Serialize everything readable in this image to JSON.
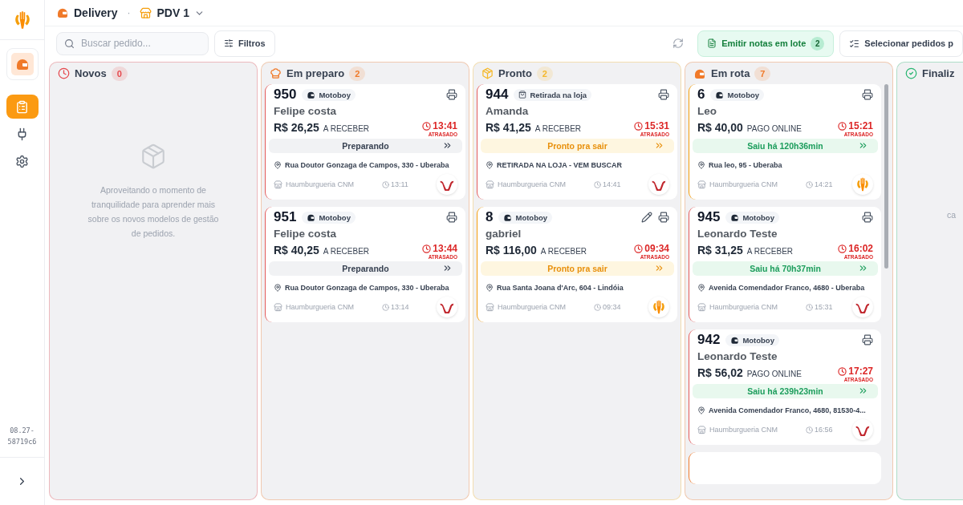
{
  "header": {
    "title": "Delivery",
    "separator": "·",
    "store": "PDV 1"
  },
  "sidebar": {
    "nav": [
      {
        "kind": "orders",
        "selected": true
      },
      {
        "kind": "integrations",
        "selected": false
      },
      {
        "kind": "settings",
        "selected": false
      }
    ],
    "version": "08.27-58719c6"
  },
  "toolbar": {
    "search": {
      "placeholder": "Buscar pedido..."
    },
    "filters": "Filtros",
    "emit": {
      "label": "Emitir notas em lote",
      "count": "2"
    },
    "select": "Selecionar pedidos p"
  },
  "columns": [
    {
      "kind": "clock",
      "title": "Novos",
      "count": "0",
      "color": "#e5484d",
      "empty_text": "Aproveitando o momento de tranquilidade para aprender mais sobre os novos modelos de gestão de pedidos."
    },
    {
      "kind": "chef",
      "title": "Em preparo",
      "count": "2",
      "color": "#f07a2a",
      "cards": [
        {
          "number": "950",
          "tag": {
            "kind": "motoboy",
            "label": "Motoboy"
          },
          "name": "Felipe costa",
          "price": "R$ 26,25",
          "payment": "A RECEBER",
          "due": "13:41",
          "late": "ATRASADO",
          "status": {
            "kind": "preparing",
            "label": "Preparando"
          },
          "address": "Rua Doutor Gonzaga de Campos, 330 - Uberaba",
          "store": "Haumburgueria CNM",
          "time": "13:11",
          "logo": {
            "kind": "wave"
          },
          "editable": false
        },
        {
          "number": "951",
          "tag": {
            "kind": "motoboy",
            "label": "Motoboy"
          },
          "name": "Felipe costa",
          "price": "R$ 40,25",
          "payment": "A RECEBER",
          "due": "13:44",
          "late": "ATRASADO",
          "status": {
            "kind": "preparing",
            "label": "Preparando"
          },
          "address": "Rua Doutor Gonzaga de Campos, 330 - Uberaba",
          "store": "Haumburgueria CNM",
          "time": "13:14",
          "logo": {
            "kind": "wave"
          },
          "editable": false
        }
      ]
    },
    {
      "kind": "box",
      "title": "Pronto",
      "count": "2",
      "color": "#f5b82a",
      "cards": [
        {
          "number": "944",
          "tag": {
            "kind": "pickup",
            "label": "Retirada na loja"
          },
          "name": "Amanda",
          "price": "R$ 41,25",
          "payment": "A RECEBER",
          "due": "15:31",
          "late": "ATRASADO",
          "status": {
            "kind": "ready",
            "label": "Pronto pra sair"
          },
          "address": "RETIRADA NA LOJA - VEM BUSCAR",
          "store": "Haumburgueria CNM",
          "time": "14:41",
          "logo": {
            "kind": "wave"
          },
          "editable": false
        },
        {
          "number": "8",
          "tag": {
            "kind": "motoboy",
            "label": "Motoboy"
          },
          "name": "gabriel",
          "price": "R$ 116,00",
          "payment": "A RECEBER",
          "due": "09:34",
          "late": "ATRASADO",
          "status": {
            "kind": "ready",
            "label": "Pronto pra sair"
          },
          "address": "Rua Santa Joana d'Arc, 604 - Lindóia",
          "store": "Haumburgueria CNM",
          "time": "09:34",
          "logo": {
            "kind": "hand"
          },
          "editable": true
        }
      ]
    },
    {
      "kind": "helmet",
      "title": "Em rota",
      "count": "7",
      "color": "#f07a2a",
      "cards": [
        {
          "number": "6",
          "tag": {
            "kind": "motoboy",
            "label": "Motoboy"
          },
          "name": "Leo",
          "price": "R$ 40,00",
          "payment": "PAGO ONLINE",
          "due": "15:21",
          "late": "ATRASADO",
          "status": {
            "kind": "out",
            "label": "Saiu há 120h36min"
          },
          "address": "Rua leo, 95 - Uberaba",
          "store": "Haumburgueria CNM",
          "time": "14:21",
          "logo": {
            "kind": "hand"
          },
          "editable": false
        },
        {
          "number": "945",
          "tag": {
            "kind": "motoboy",
            "label": "Motoboy"
          },
          "name": "Leonardo Teste",
          "price": "R$ 31,25",
          "payment": "A RECEBER",
          "due": "16:02",
          "late": "ATRASADO",
          "status": {
            "kind": "out",
            "label": "Saiu há 70h37min"
          },
          "address": "Avenida Comendador Franco, 4680 - Uberaba",
          "store": "Haumburgueria CNM",
          "time": "15:31",
          "logo": {
            "kind": "wave"
          },
          "editable": false
        },
        {
          "number": "942",
          "tag": {
            "kind": "motoboy",
            "label": "Motoboy"
          },
          "name": "Leonardo Teste",
          "price": "R$ 56,02",
          "payment": "PAGO ONLINE",
          "due": "17:27",
          "late": "ATRASADO",
          "status": {
            "kind": "out",
            "label": "Saiu há 239h23min"
          },
          "address": "Avenida Comendador Franco, 4680, 81530-4...",
          "store": "Haumburgueria CNM",
          "time": "16:56",
          "logo": {
            "kind": "wave"
          },
          "editable": false
        }
      ]
    },
    {
      "kind": "check",
      "title": "Finaliz",
      "color": "#2bb673",
      "empty_text": "ca"
    }
  ]
}
